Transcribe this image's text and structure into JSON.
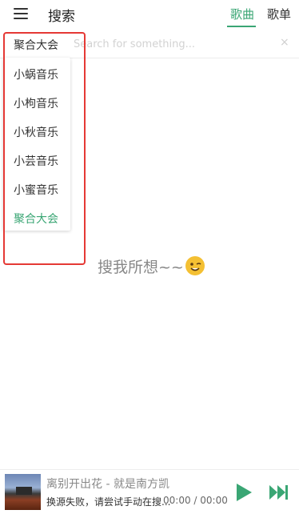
{
  "header": {
    "title": "搜索",
    "tabs": [
      {
        "label": "歌曲",
        "active": true
      },
      {
        "label": "歌单",
        "active": false
      }
    ]
  },
  "search": {
    "source_label": "聚合大会",
    "placeholder": "Search for something...",
    "value": ""
  },
  "dropdown": {
    "items": [
      {
        "label": "小蜗音乐",
        "active": false
      },
      {
        "label": "小枸音乐",
        "active": false
      },
      {
        "label": "小秋音乐",
        "active": false
      },
      {
        "label": "小芸音乐",
        "active": false
      },
      {
        "label": "小蜜音乐",
        "active": false
      },
      {
        "label": "聚合大会",
        "active": true
      }
    ]
  },
  "empty_state": {
    "text": "搜我所想~~",
    "emoji": "wink-face-icon"
  },
  "player": {
    "song_title": "离别开出花 - 就是南方凯",
    "status": "换源失败，请尝试手动在搜...",
    "time": "00:00 / 00:00"
  },
  "colors": {
    "accent": "#3aa674",
    "highlight": "#e53935"
  }
}
